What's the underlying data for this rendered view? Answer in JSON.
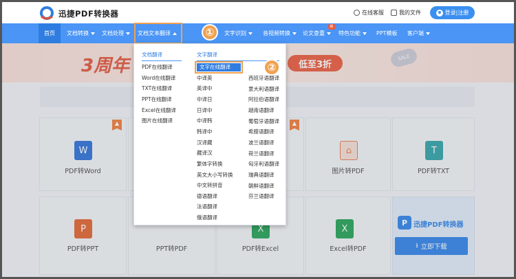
{
  "header": {
    "brand": "迅捷PDF转换器",
    "service": "在线客服",
    "my_files": "我的文件",
    "login": "登录|注册"
  },
  "nav": {
    "items": [
      {
        "label": "首页"
      },
      {
        "label": "文档转换"
      },
      {
        "label": "文档处理"
      },
      {
        "label": "文档文本翻译"
      },
      {
        "label": "文字识别"
      },
      {
        "label": "音视频转换"
      },
      {
        "label": "论文查重"
      },
      {
        "label": "特色功能"
      },
      {
        "label": "PPT模板"
      },
      {
        "label": "客户端"
      }
    ],
    "new_badge": "新"
  },
  "banner": {
    "headline": "3周年",
    "pill": "低至3折",
    "sale": "SALE"
  },
  "dropdown": {
    "col1_head": "文档翻译",
    "col1": [
      "PDF在线翻译",
      "Word在线翻译",
      "TXT在线翻译",
      "PPT在线翻译",
      "Excel在线翻译",
      "图片在线翻译"
    ],
    "col2_head": "文字翻译",
    "col2": [
      "文字在线翻译",
      "中译英",
      "英译中",
      "中译日",
      "日译中",
      "中译韩",
      "韩译中",
      "汉译藏",
      "藏译汉",
      "繁体字转换",
      "英文大小写转换",
      "中文转拼音",
      "德语翻译",
      "法语翻译",
      "俄语翻译"
    ],
    "col3": [
      "西班牙语翻译",
      "意大利语翻译",
      "阿拉伯语翻译",
      "越南语翻译",
      "葡萄牙语翻译",
      "希腊语翻译",
      "波兰语翻译",
      "荷兰语翻译",
      "匈牙利语翻译",
      "瑞典语翻译",
      "朝鲜语翻译",
      "芬兰语翻译"
    ]
  },
  "cards": {
    "pdf2word": "PDF转Word",
    "img2pdf": "图片转PDF",
    "pdf2txt": "PDF转TXT",
    "pdf2ppt": "PDF转PPT",
    "ppt2pdf": "PPT转PDF",
    "pdf2excel": "PDF转Excel",
    "excel2pdf": "Excel转PDF"
  },
  "promo": {
    "title": "迅捷PDF转换器",
    "download": "立即下载"
  },
  "steps": [
    "①",
    "②"
  ],
  "colors": {
    "nav": "#4a95f5",
    "accent": "#2f7de0",
    "highlight": "#f0a150"
  }
}
